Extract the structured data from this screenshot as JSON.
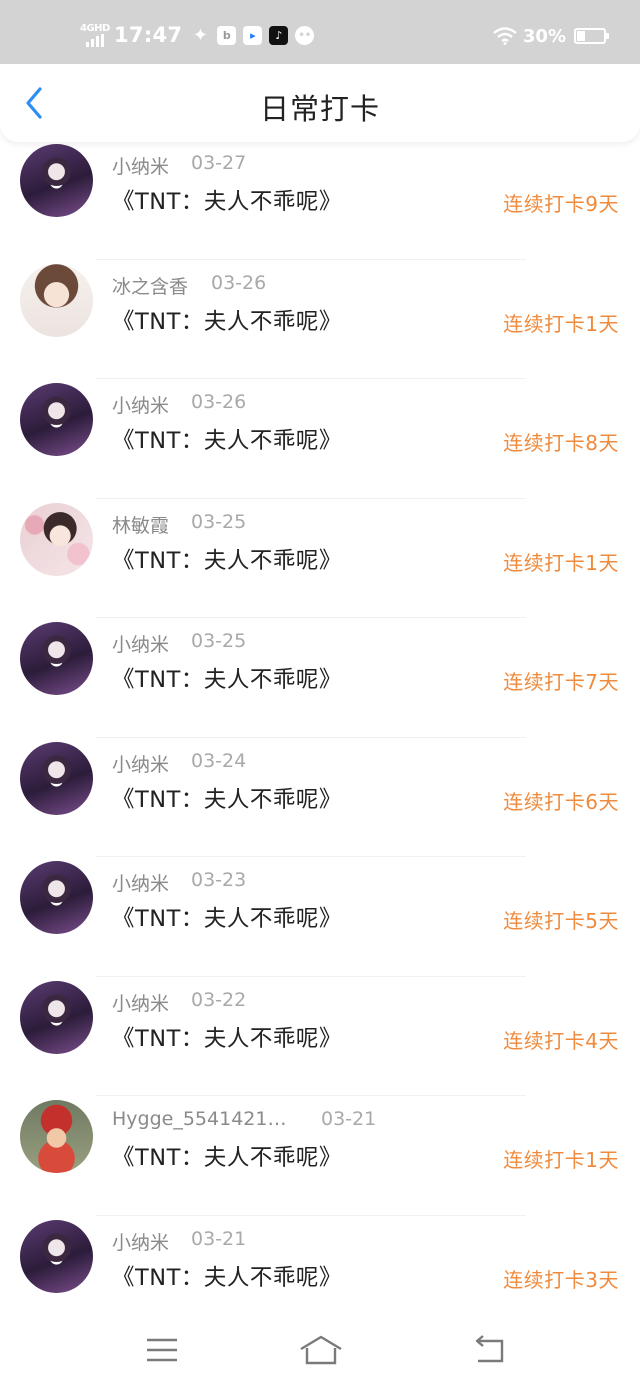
{
  "status_bar": {
    "network": "4GHD",
    "time": "17:47",
    "battery_pct": "30%",
    "notification_icons": [
      "wechat-icon",
      "app-icon",
      "blue-app-icon",
      "tiktok-icon",
      "message-icon"
    ]
  },
  "header": {
    "title": "日常打卡",
    "back_icon": "chevron-left-icon"
  },
  "colors": {
    "accent": "#2a8ef5",
    "streak": "#f08a3c",
    "status_bar": "#d3d3d3"
  },
  "entries": [
    {
      "name": "小纳米",
      "date": "03-27",
      "book": "《TNT：夫人不乖呢》",
      "streak": "连续打卡9天",
      "avatar": "purple"
    },
    {
      "name": "冰之含香",
      "date": "03-26",
      "book": "《TNT：夫人不乖呢》",
      "streak": "连续打卡1天",
      "avatar": "portrait"
    },
    {
      "name": "小纳米",
      "date": "03-26",
      "book": "《TNT：夫人不乖呢》",
      "streak": "连续打卡8天",
      "avatar": "purple"
    },
    {
      "name": "林敏霞",
      "date": "03-25",
      "book": "《TNT：夫人不乖呢》",
      "streak": "连续打卡1天",
      "avatar": "floral"
    },
    {
      "name": "小纳米",
      "date": "03-25",
      "book": "《TNT：夫人不乖呢》",
      "streak": "连续打卡7天",
      "avatar": "purple"
    },
    {
      "name": "小纳米",
      "date": "03-24",
      "book": "《TNT：夫人不乖呢》",
      "streak": "连续打卡6天",
      "avatar": "purple"
    },
    {
      "name": "小纳米",
      "date": "03-23",
      "book": "《TNT：夫人不乖呢》",
      "streak": "连续打卡5天",
      "avatar": "purple"
    },
    {
      "name": "小纳米",
      "date": "03-22",
      "book": "《TNT：夫人不乖呢》",
      "streak": "连续打卡4天",
      "avatar": "purple"
    },
    {
      "name": "Hygge_5541421…",
      "date": "03-21",
      "book": "《TNT：夫人不乖呢》",
      "streak": "连续打卡1天",
      "avatar": "child"
    },
    {
      "name": "小纳米",
      "date": "03-21",
      "book": "《TNT：夫人不乖呢》",
      "streak": "连续打卡3天",
      "avatar": "purple"
    }
  ],
  "nav_bar": {
    "icons": [
      "menu-icon",
      "home-icon",
      "back-icon"
    ]
  }
}
